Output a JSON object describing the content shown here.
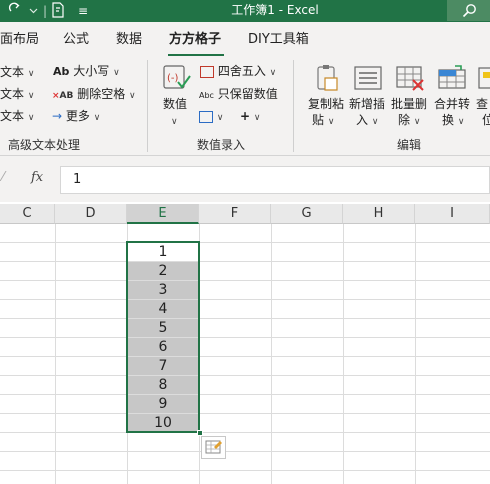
{
  "titlebar": {
    "title": "工作簿1  -  Excel",
    "redo_icon": "redo-icon",
    "sep_glyph": "|",
    "customize_glyph": "≡",
    "search_icon": "search-icon"
  },
  "tabs": {
    "items": [
      "面布局",
      "公式",
      "数据",
      "方方格子",
      "DIY工具箱"
    ],
    "active": "方方格子"
  },
  "ribbon": {
    "text_group": {
      "row1": "文本",
      "row2": "文本",
      "row3": "文本",
      "case_label": "大小写",
      "remove_space_label": "删除空格",
      "more_label": "更多",
      "group_name": "高级文本处理"
    },
    "number_group": {
      "number_label": "数值",
      "round_label": "四舍五入",
      "keep_numbers_label": "只保留数值",
      "plus_glyph": "+",
      "group_name": "数值录入"
    },
    "edit_group": {
      "copy_paste_label_1": "复制粘",
      "copy_paste_label_2": "贴",
      "insert_label_1": "新增插",
      "insert_label_2": "入",
      "batch_delete_label_1": "批量删",
      "batch_delete_label_2": "除",
      "merge_label_1": "合并转",
      "merge_label_2": "换",
      "find_label_1": "查",
      "find_label_2": "位",
      "group_name": "编辑"
    }
  },
  "formula_bar": {
    "fx": "fx",
    "value": "1"
  },
  "grid": {
    "columns": [
      "C",
      "D",
      "E",
      "F",
      "G",
      "H",
      "I"
    ],
    "selected_column": "E",
    "e_values": [
      "1",
      "2",
      "3",
      "4",
      "5",
      "6",
      "7",
      "8",
      "9",
      "10"
    ]
  },
  "colors": {
    "excel_green": "#217346",
    "selection_fill": "#c7c7c7"
  }
}
